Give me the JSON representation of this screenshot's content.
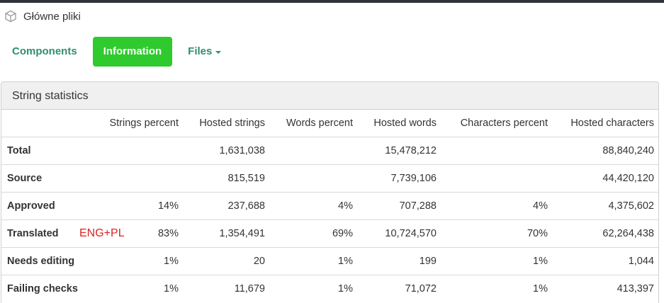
{
  "breadcrumb": {
    "icon": "cube-icon",
    "label": "Główne pliki"
  },
  "tabs": [
    {
      "label": "Components",
      "active": false
    },
    {
      "label": "Information",
      "active": true
    },
    {
      "label": "Files",
      "active": false,
      "dropdown": true
    }
  ],
  "colors": {
    "accent": "#2f8f6f",
    "active_tab": "#2eca2e",
    "annotation": "#e02020"
  },
  "stats": {
    "title": "String statistics",
    "columns": [
      "",
      "Strings percent",
      "Hosted strings",
      "Words percent",
      "Hosted words",
      "Characters percent",
      "Hosted characters"
    ],
    "rows": [
      {
        "label": "Total",
        "cells": [
          "",
          "1,631,038",
          "",
          "15,478,212",
          "",
          "88,840,240"
        ]
      },
      {
        "label": "Source",
        "cells": [
          "",
          "815,519",
          "",
          "7,739,106",
          "",
          "44,420,120"
        ]
      },
      {
        "label": "Approved",
        "cells": [
          "14%",
          "237,688",
          "4%",
          "707,288",
          "4%",
          "4,375,602"
        ]
      },
      {
        "label": "Translated",
        "cells": [
          "83%",
          "1,354,491",
          "69%",
          "10,724,570",
          "70%",
          "62,264,438"
        ]
      },
      {
        "label": "Needs editing",
        "cells": [
          "1%",
          "20",
          "1%",
          "199",
          "1%",
          "1,044"
        ]
      },
      {
        "label": "Failing checks",
        "cells": [
          "1%",
          "11,679",
          "1%",
          "71,072",
          "1%",
          "413,397"
        ]
      }
    ],
    "annotation": "ENG+PL"
  }
}
